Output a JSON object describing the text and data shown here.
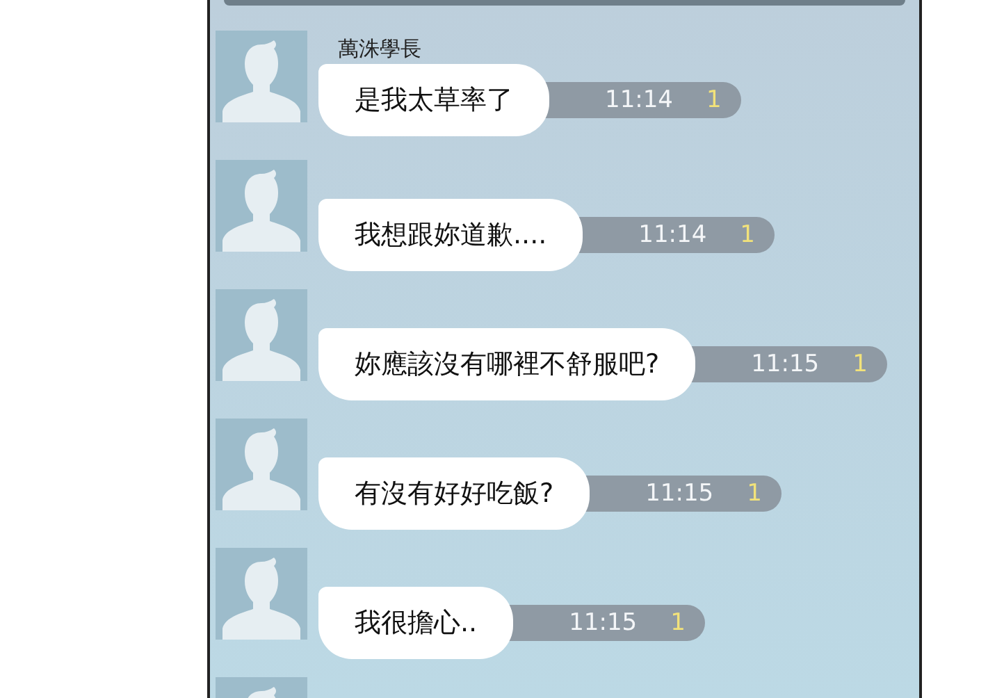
{
  "chat": {
    "sender": "萬洙學長",
    "messages": [
      {
        "kind": "message",
        "text": "是我太草率了",
        "time": "11:14",
        "unread": "1"
      },
      {
        "kind": "message",
        "text": "我想跟妳道歉....",
        "time": "11:14",
        "unread": "1"
      },
      {
        "kind": "message",
        "text": "妳應該沒有哪裡不舒服吧?",
        "time": "11:15",
        "unread": "1"
      },
      {
        "kind": "message",
        "text": "有沒有好好吃飯?",
        "time": "11:15",
        "unread": "1"
      },
      {
        "kind": "message",
        "text": "我很擔心..",
        "time": "11:15",
        "unread": "1"
      },
      {
        "kind": "avatar-only"
      }
    ]
  }
}
